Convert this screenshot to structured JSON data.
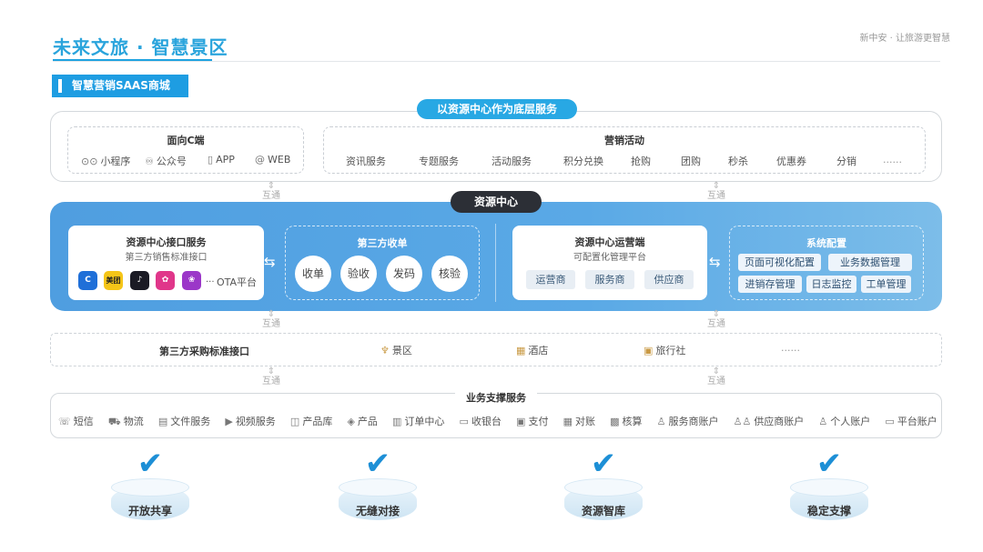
{
  "header": {
    "title": "未来文旅 · 智慧景区",
    "tagline": "新中安 · 让旅游更智慧",
    "section_tag": "智慧营销SAAS商城"
  },
  "top_block": {
    "pill": "以资源中心作为底层服务",
    "c_end": {
      "title": "面向C端",
      "items": [
        {
          "icon": "mini-program-icon",
          "label": "小程序"
        },
        {
          "icon": "wechat-icon",
          "label": "公众号"
        },
        {
          "icon": "phone-icon",
          "label": "APP"
        },
        {
          "icon": "at-icon",
          "label": "WEB"
        }
      ]
    },
    "marketing": {
      "title": "营销活动",
      "items": [
        "资讯服务",
        "专题服务",
        "活动服务",
        "积分兑换",
        "抢购",
        "团购",
        "秒杀",
        "优惠券",
        "分销",
        "......"
      ]
    }
  },
  "connector_label": "互通",
  "resource_center": {
    "pill": "资源中心",
    "interface": {
      "title": "资源中心接口服务",
      "subtitle": "第三方销售标准接口",
      "ota_icons": [
        {
          "name": "ctrip-logo",
          "text": "C",
          "color": "#1f6fd8"
        },
        {
          "name": "meituan-logo",
          "text": "美团",
          "color": "#f5c518"
        },
        {
          "name": "douyin-logo",
          "text": "♪",
          "color": "#1a1a24"
        },
        {
          "name": "ota-logo-pink",
          "text": "✿",
          "color": "#e0368a"
        },
        {
          "name": "ota-logo-purple",
          "text": "❀",
          "color": "#9b37c8"
        }
      ],
      "ellipsis": "...",
      "ota_label": "OTA平台"
    },
    "third_party_collect": {
      "title": "第三方收单",
      "items": [
        "收单",
        "验收",
        "发码",
        "核验"
      ]
    },
    "operations": {
      "title": "资源中心运营端",
      "subtitle": "可配置化管理平台",
      "items": [
        "运营商",
        "服务商",
        "供应商"
      ]
    },
    "system_config": {
      "title": "系统配置",
      "row1": [
        "页面可视化配置",
        "业务数据管理"
      ],
      "row2": [
        "进销存管理",
        "日志监控",
        "工单管理"
      ]
    }
  },
  "procurement": {
    "title": "第三方采购标准接口",
    "items": [
      {
        "icon": "scenic-icon",
        "label": "景区"
      },
      {
        "icon": "hotel-icon",
        "label": "酒店"
      },
      {
        "icon": "travel-agency-icon",
        "label": "旅行社"
      }
    ],
    "ellipsis": "......"
  },
  "support": {
    "title": "业务支撑服务",
    "items": [
      {
        "icon": "sms-icon",
        "label": "短信"
      },
      {
        "icon": "logistics-icon",
        "label": "物流"
      },
      {
        "icon": "file-icon",
        "label": "文件服务"
      },
      {
        "icon": "video-icon",
        "label": "视频服务"
      },
      {
        "icon": "product-library-icon",
        "label": "产品库"
      },
      {
        "icon": "product-icon",
        "label": "产品"
      },
      {
        "icon": "order-icon",
        "label": "订单中心"
      },
      {
        "icon": "cashier-icon",
        "label": "收银台"
      },
      {
        "icon": "payment-icon",
        "label": "支付"
      },
      {
        "icon": "reconcile-icon",
        "label": "对账"
      },
      {
        "icon": "accounting-icon",
        "label": "核算"
      },
      {
        "icon": "provider-account-icon",
        "label": "服务商账户"
      },
      {
        "icon": "supplier-account-icon",
        "label": "供应商账户"
      },
      {
        "icon": "personal-account-icon",
        "label": "个人账户"
      },
      {
        "icon": "platform-account-icon",
        "label": "平台账户"
      }
    ]
  },
  "pillars": [
    "开放共享",
    "无缝对接",
    "资源智库",
    "稳定支撑"
  ],
  "colors": {
    "accent": "#28a8e4",
    "band": "#5aa9e6",
    "dark_pill": "#2c2f36"
  }
}
